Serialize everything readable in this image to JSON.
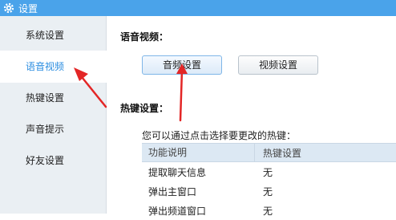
{
  "window": {
    "title": "设置"
  },
  "sidebar": {
    "items": [
      {
        "label": "系统设置"
      },
      {
        "label": "语音视频"
      },
      {
        "label": "热键设置"
      },
      {
        "label": "声音提示"
      },
      {
        "label": "好友设置"
      }
    ],
    "active_index": 1
  },
  "av_section": {
    "title": "语音视频：",
    "audio_button": "音频设置",
    "video_button": "视频设置"
  },
  "hotkey_section": {
    "title": "热键设置：",
    "hint": "您可以通过点击选择要更改的热键：",
    "columns": [
      "功能说明",
      "热键设置"
    ],
    "rows": [
      {
        "function": "提取聊天信息",
        "hotkey": "无"
      },
      {
        "function": "弹出主窗口",
        "hotkey": "无"
      },
      {
        "function": "弹出频道窗口",
        "hotkey": "无"
      }
    ]
  },
  "colors": {
    "titlebar": "#4aa3ea",
    "accent": "#2b8de0",
    "annotation_arrow": "#e32626"
  }
}
